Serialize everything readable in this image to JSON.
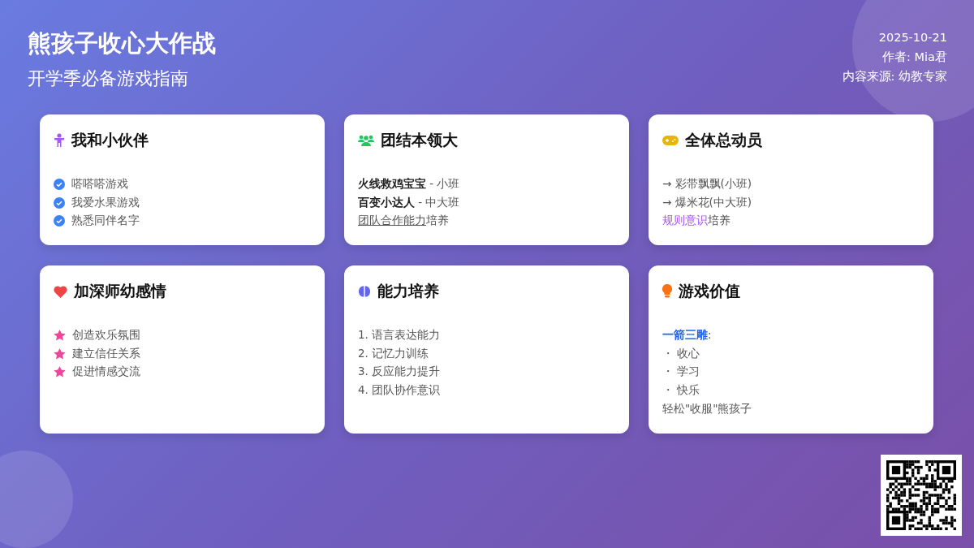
{
  "header": {
    "title": "熊孩子收心大作战",
    "subtitle": "开学季必备游戏指南"
  },
  "meta": [
    "2025-10-21",
    "作者: Mia君",
    "内容来源: 幼教专家"
  ],
  "cards": [
    {
      "title": "我和小伙伴",
      "lines": [
        [
          {
            "text": "嗒嗒嗒游戏",
            "kind": "plain"
          }
        ],
        [
          {
            "text": "我爱水果游戏",
            "kind": "plain"
          }
        ],
        [
          {
            "text": "熟悉同伴名字",
            "kind": "plain"
          }
        ]
      ]
    },
    {
      "title": "团结本领大",
      "lines": [
        [
          {
            "text": "火线救鸡宝宝",
            "kind": "bold"
          },
          {
            "text": " - 小班",
            "kind": "plain"
          }
        ],
        [
          {
            "text": "百变小达人",
            "kind": "bold"
          },
          {
            "text": " - 中大班",
            "kind": "plain"
          }
        ],
        [
          {
            "text": "团队合作能力",
            "kind": "underline"
          },
          {
            "text": "培养",
            "kind": "plain"
          }
        ]
      ]
    },
    {
      "title": "全体总动员",
      "lines": [
        [
          {
            "text": "→ 彩带飘飘(小班)",
            "kind": "plain"
          }
        ],
        [
          {
            "text": "→ 爆米花(中大班)",
            "kind": "plain"
          }
        ],
        [
          {
            "text": "规则意识",
            "kind": "accent"
          },
          {
            "text": "培养",
            "kind": "plain"
          }
        ]
      ]
    },
    {
      "title": "加深师幼感情",
      "lines": [
        [
          {
            "text": "创造欢乐氛围",
            "kind": "plain"
          }
        ],
        [
          {
            "text": "建立信任关系",
            "kind": "plain"
          }
        ],
        [
          {
            "text": "促进情感交流",
            "kind": "plain"
          }
        ]
      ]
    },
    {
      "title": "能力培养",
      "lines": [
        [
          {
            "text": "1. 语言表达能力",
            "kind": "plain"
          }
        ],
        [
          {
            "text": "2. 记忆力训练",
            "kind": "plain"
          }
        ],
        [
          {
            "text": "3. 反应能力提升",
            "kind": "plain"
          }
        ],
        [
          {
            "text": "4. 团队协作意识",
            "kind": "plain"
          }
        ]
      ]
    },
    {
      "title": "游戏价值",
      "lines": [
        [
          {
            "text": "一箭三雕",
            "kind": "highlight"
          },
          {
            "text": ":",
            "kind": "plain"
          }
        ],
        [
          {
            "text": "・ 收心",
            "kind": "plain"
          }
        ],
        [
          {
            "text": "・ 学习",
            "kind": "plain"
          }
        ],
        [
          {
            "text": "・ 快乐",
            "kind": "plain"
          }
        ],
        [
          {
            "text": "轻松\"收服\"熊孩子",
            "kind": "plain"
          }
        ]
      ]
    }
  ]
}
